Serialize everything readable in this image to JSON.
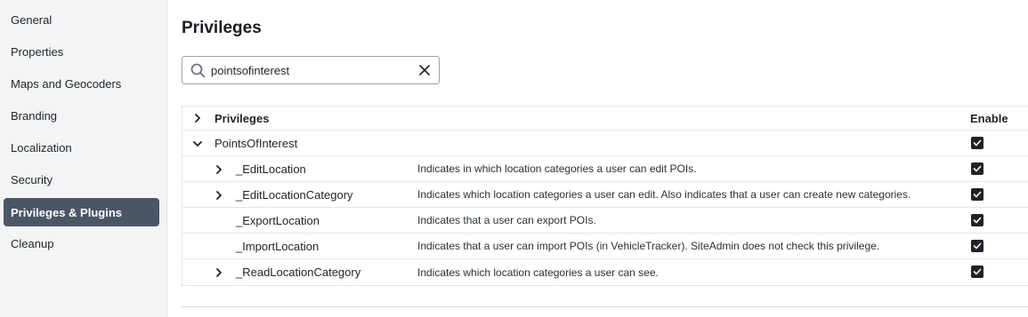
{
  "sidebar": {
    "items": [
      {
        "label": "General"
      },
      {
        "label": "Properties"
      },
      {
        "label": "Maps and Geocoders"
      },
      {
        "label": "Branding"
      },
      {
        "label": "Localization"
      },
      {
        "label": "Security"
      },
      {
        "label": "Privileges & Plugins",
        "active": true
      },
      {
        "label": "Cleanup"
      }
    ]
  },
  "main": {
    "title": "Privileges",
    "search": {
      "value": "pointsofinterest",
      "placeholder": ""
    },
    "table": {
      "header": {
        "name": "Privileges",
        "enable": "Enable"
      },
      "group": {
        "name": "PointsOfInterest",
        "enabled": true
      },
      "rows": [
        {
          "name": "_EditLocation",
          "description": "Indicates in which location categories a user can edit POIs.",
          "expandable": true,
          "enabled": true
        },
        {
          "name": "_EditLocationCategory",
          "description": "Indicates which location categories a user can edit. Also indicates that a user can create new categories.",
          "expandable": true,
          "enabled": true
        },
        {
          "name": "_ExportLocation",
          "description": "Indicates that a user can export POIs.",
          "expandable": false,
          "enabled": true
        },
        {
          "name": "_ImportLocation",
          "description": "Indicates that a user can import POIs (in VehicleTracker). SiteAdmin does not check this privilege.",
          "expandable": false,
          "enabled": true
        },
        {
          "name": "_ReadLocationCategory",
          "description": "Indicates which location categories a user can see.",
          "expandable": true,
          "enabled": true
        }
      ]
    }
  },
  "icons": {
    "search": "search-icon",
    "clear": "close-icon",
    "expand": "chevron-right-icon",
    "collapse": "chevron-down-icon",
    "check": "check-icon"
  },
  "colors": {
    "sidebar_bg": "#f3f4f6",
    "active_item_bg": "#4c5566",
    "checkbox_fill": "#1f2328"
  }
}
